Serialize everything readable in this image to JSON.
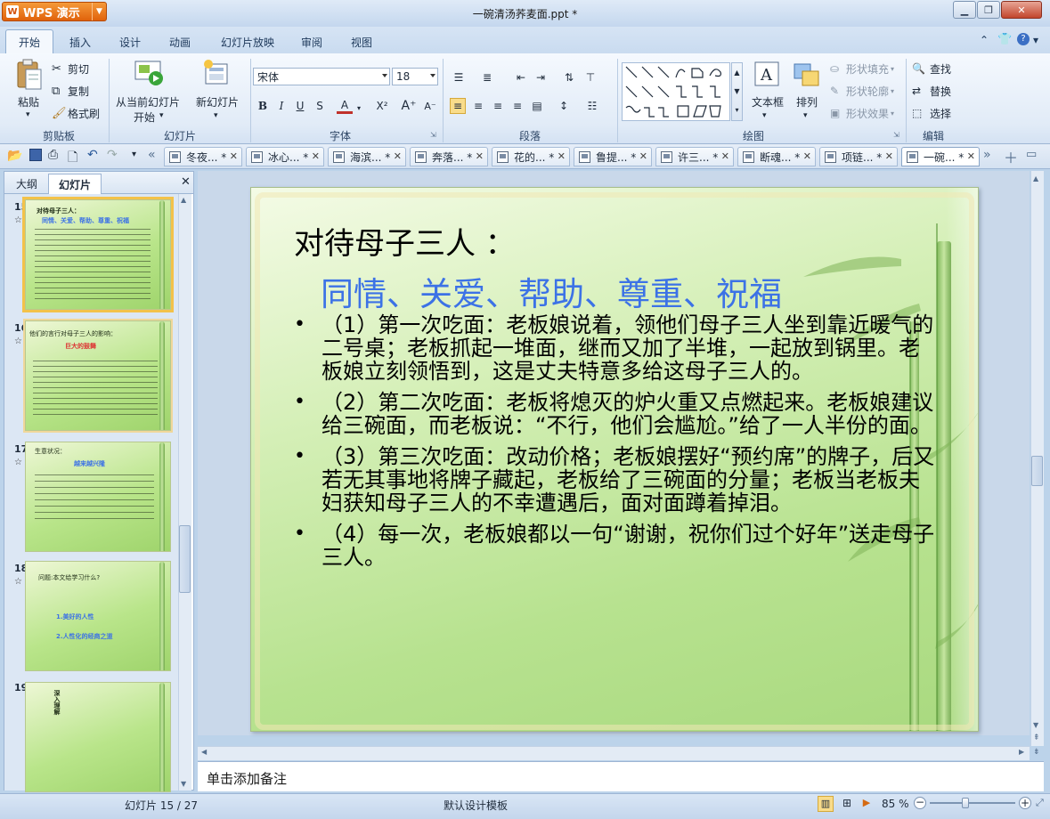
{
  "window": {
    "app_button": "WPS 演示",
    "title": "一碗清汤荞麦面.ppt *"
  },
  "ribbon_tabs": [
    "开始",
    "插入",
    "设计",
    "动画",
    "幻灯片放映",
    "审阅",
    "视图"
  ],
  "ribbon": {
    "clipboard": {
      "paste": "粘贴",
      "cut": "剪切",
      "copy": "复制",
      "format_painter": "格式刷",
      "group": "剪贴板"
    },
    "slides": {
      "from_current": "从当前幻灯片",
      "start": "开始",
      "new_slide": "新幻灯片",
      "group": "幻灯片"
    },
    "font": {
      "name": "宋体",
      "size": "18",
      "group": "字体"
    },
    "paragraph": {
      "group": "段落"
    },
    "drawing": {
      "textbox": "文本框",
      "arrange": "排列",
      "fill": "形状填充",
      "outline": "形状轮廓",
      "effect": "形状效果",
      "group": "绘图"
    },
    "edit": {
      "find": "查找",
      "replace": "替换",
      "select": "选择",
      "group": "编辑"
    }
  },
  "doc_tabs": [
    "冬夜... *",
    "冰心... *",
    "海滨... *",
    "奔落... *",
    "花的... *",
    "鲁提... *",
    "许三... *",
    "断魂... *",
    "项链... *",
    "一碗... *"
  ],
  "panel": {
    "outline_tab": "大纲",
    "slides_tab": "幻灯片"
  },
  "thumbnails": [
    {
      "num": "15",
      "title": "对待母子三人：",
      "sub": "同情、关爱、帮助、尊重、祝福"
    },
    {
      "num": "16",
      "title": "他们的言行对母子三人的影响：",
      "sub": "巨大的鼓舞"
    },
    {
      "num": "17",
      "title": "生意状况：",
      "sub": "越来越兴隆"
    },
    {
      "num": "18",
      "title": "问题:本文给学习什么?",
      "item1": "1.美好的人性",
      "item2": "2.人性化的经商之道"
    },
    {
      "num": "19",
      "title": "深入理解"
    }
  ],
  "slide": {
    "title": "对待母子三人 ：",
    "subtitle": "同情、关爱、帮助、尊重、祝福",
    "bullets": [
      "（1）第一次吃面：老板娘说着，领他们母子三人坐到靠近暖气的二号桌；老板抓起一堆面，继而又加了半堆，一起放到锅里。老板娘立刻领悟到，这是丈夫特意多给这母子三人的。",
      "（2）第二次吃面：老板将熄灭的炉火重又点燃起来。老板娘建议给三碗面，而老板说：“不行，他们会尴尬。”给了一人半份的面。",
      "（3）第三次吃面：改动价格；老板娘摆好“预约席”的牌子，后又若无其事地将牌子藏起，老板给了三碗面的分量；老板当老板夫妇获知母子三人的不幸遭遇后，面对面蹲着掉泪。",
      "（4）每一次，老板娘都以一句“谢谢，祝你们过个好年”送走母子三人。"
    ]
  },
  "notes_placeholder": "单击添加备注",
  "status": {
    "slide_counter": "幻灯片 15 / 27",
    "template": "默认设计模板",
    "zoom": "85 %"
  }
}
